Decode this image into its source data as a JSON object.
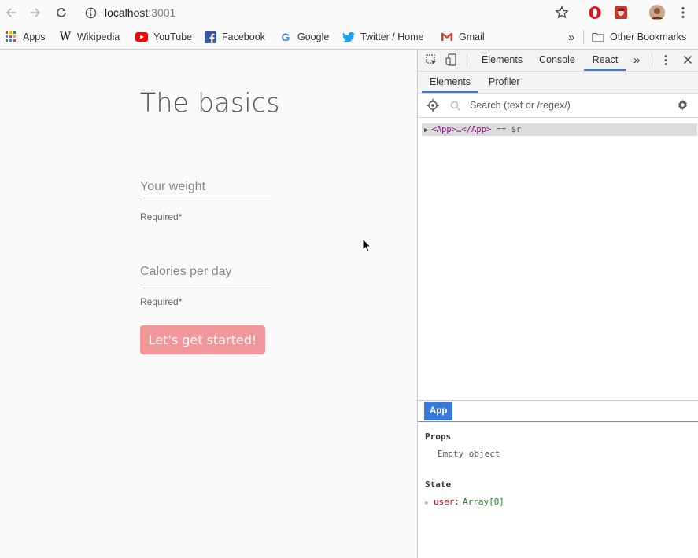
{
  "browser": {
    "url_host": "localhost",
    "url_port": ":3001",
    "bookmarks": [
      {
        "label": "Apps"
      },
      {
        "label": "Wikipedia"
      },
      {
        "label": "YouTube"
      },
      {
        "label": "Facebook"
      },
      {
        "label": "Google"
      },
      {
        "label": "Twitter / Home"
      },
      {
        "label": "Gmail"
      }
    ],
    "overflow_label": "»",
    "other_bookmarks": "Other Bookmarks"
  },
  "page": {
    "title": "The basics",
    "fields": [
      {
        "placeholder": "Your weight",
        "helper": "Required*"
      },
      {
        "placeholder": "Calories per day",
        "helper": "Required*"
      }
    ],
    "cta_label": "Let's get started!",
    "cta_color": "#f0979a"
  },
  "devtools": {
    "tabs": [
      "Elements",
      "Console",
      "React"
    ],
    "active_tab": "React",
    "more_tabs": "»",
    "subtabs": [
      "Elements",
      "Profiler"
    ],
    "search_placeholder": "Search (text or /regex/)",
    "tree": {
      "open_tag": "<App>",
      "ellipsis": "…",
      "close_tag": "</App>",
      "suffix": " == $r"
    },
    "selected_component": "App",
    "props_heading": "Props",
    "props_value": "Empty object",
    "state_heading": "State",
    "state_key": "user:",
    "state_value": "Array[0]",
    "accent_color": "#3879d9"
  }
}
